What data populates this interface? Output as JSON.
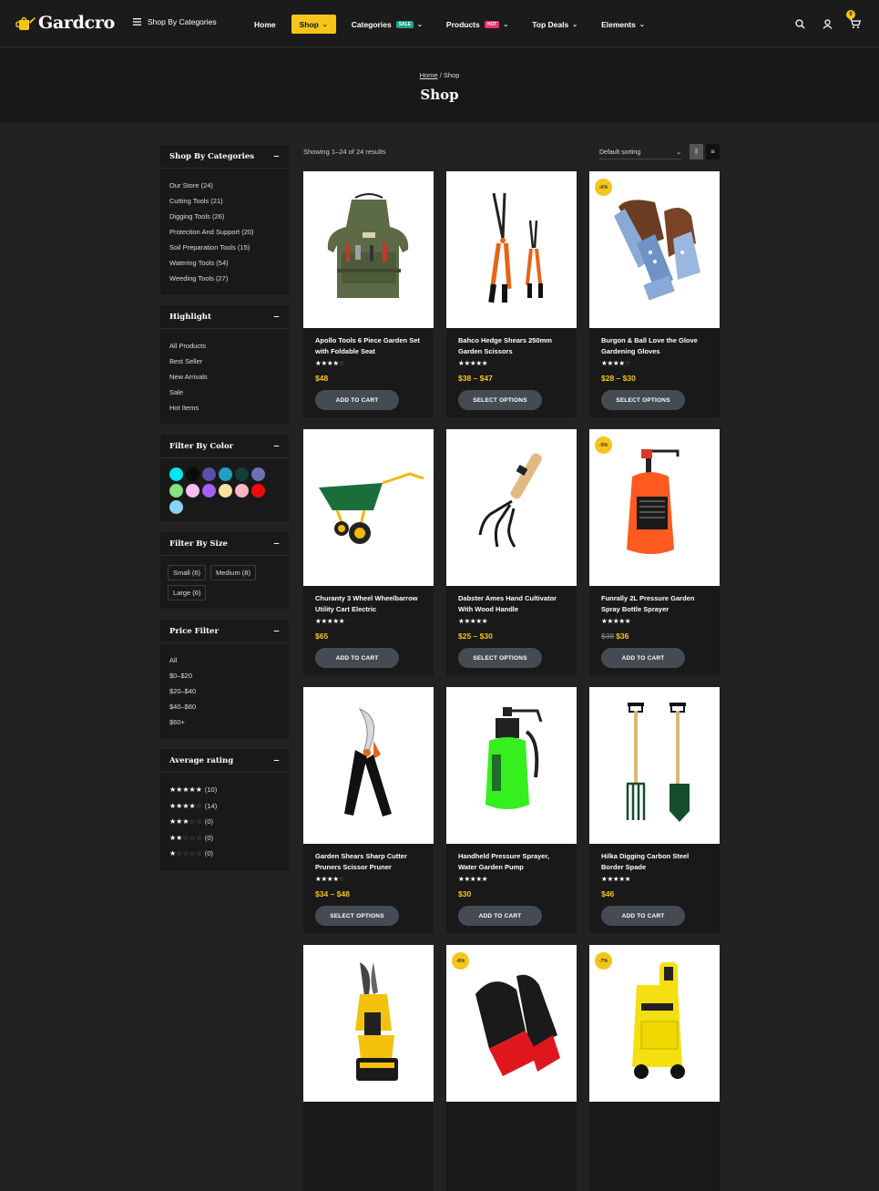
{
  "header": {
    "logo_text": "Gardcro",
    "shop_by_categories": "Shop By Categories",
    "nav": [
      {
        "label": "Home"
      },
      {
        "label": "Shop"
      },
      {
        "label": "Categories",
        "badge": "SALE"
      },
      {
        "label": "Products",
        "badge": "HOT"
      },
      {
        "label": "Top Deals"
      },
      {
        "label": "Elements"
      }
    ],
    "cart_count": "0"
  },
  "banner": {
    "crumb_home": "Home",
    "crumb_sep": " / ",
    "crumb_current": "Shop",
    "title": "Shop"
  },
  "sidebar": {
    "categories": {
      "title": "Shop By Categories",
      "items": [
        "Our Store (24)",
        "Cutting Tools (21)",
        "Digging Tools (26)",
        "Protection And Support (20)",
        "Soil Preparation Tools (15)",
        "Watering Tools (54)",
        "Weeding Tools (27)"
      ]
    },
    "highlight": {
      "title": "Highlight",
      "items": [
        "All Products",
        "Best Seller",
        "New Arrivals",
        "Sale",
        "Hot Items"
      ]
    },
    "color": {
      "title": "Filter By Color",
      "swatches": [
        "#00e5f0",
        "#0b0b0b",
        "#5a4fa6",
        "#20a1c2",
        "#0f3f36",
        "#6d72b6",
        "#86e17f",
        "#f7bdf0",
        "#a55ff2",
        "#f7e2a1",
        "#f7b7c0",
        "#ee0d0d",
        "#89d3f2"
      ]
    },
    "size": {
      "title": "Filter By Size",
      "items": [
        "Small (6)",
        "Medium (8)",
        "Large (6)"
      ]
    },
    "price": {
      "title": "Price Filter",
      "items": [
        "All",
        "$0–$20",
        "$20–$40",
        "$40–$60",
        "$60+"
      ]
    },
    "rating": {
      "title": "Average rating",
      "items": [
        {
          "stars": 5,
          "count": "(10)"
        },
        {
          "stars": 4,
          "count": "(14)"
        },
        {
          "stars": 3,
          "count": "(0)"
        },
        {
          "stars": 2,
          "count": "(0)"
        },
        {
          "stars": 1,
          "count": "(0)"
        }
      ]
    }
  },
  "toolbar": {
    "results": "Showing 1–24 of 24 results",
    "sorting": "Default sorting"
  },
  "products": [
    {
      "name": "Apollo Tools 6 Piece Garden Set with Foldable Seat",
      "rating": 4,
      "price": "$48",
      "button": "ADD TO CART",
      "icon": "apron"
    },
    {
      "name": "Bahco Hedge Shears 250mm Garden Scissors",
      "rating": 5,
      "price": "$38 – $47",
      "button": "SELECT OPTIONS",
      "icon": "shears"
    },
    {
      "name": "Burgon & Ball Love the Glove Gardening Gloves",
      "rating": 4,
      "price": "$28 – $30",
      "button": "SELECT OPTIONS",
      "sale": "-6%",
      "icon": "gloves"
    },
    {
      "name": "Churanty 3 Wheel Wheelbarrow Utility Cart Electric",
      "rating": 5,
      "price": "$65",
      "button": "ADD TO CART",
      "icon": "wheelbarrow"
    },
    {
      "name": "Dabster Ames Hand Cultivator With Wood Handle",
      "rating": 5,
      "price": "$25 – $30",
      "button": "SELECT OPTIONS",
      "icon": "cultivator"
    },
    {
      "name": "Funrally 2L Pressure Garden Spray Bottle Sprayer",
      "rating": 5,
      "old_price": "$38",
      "price": "$36",
      "button": "ADD TO CART",
      "sale": "-5%",
      "icon": "sprayer-orange"
    },
    {
      "name": "Garden Shears Sharp Cutter Pruners Scissor Pruner",
      "rating": 4,
      "price": "$34 – $48",
      "button": "SELECT OPTIONS",
      "icon": "pruner"
    },
    {
      "name": "Handheld Pressure Sprayer, Water Garden Pump",
      "rating": 5,
      "price": "$30",
      "button": "ADD TO CART",
      "icon": "sprayer-green"
    },
    {
      "name": "Hilka Digging Carbon Steel Border Spade",
      "rating": 5,
      "price": "$46",
      "button": "ADD TO CART",
      "icon": "spade"
    },
    {
      "name": "",
      "icon": "electric-pruner"
    },
    {
      "name": "",
      "sale": "-6%",
      "icon": "red-gloves"
    },
    {
      "name": "",
      "sale": "-7%",
      "icon": "pressure-washer"
    }
  ]
}
